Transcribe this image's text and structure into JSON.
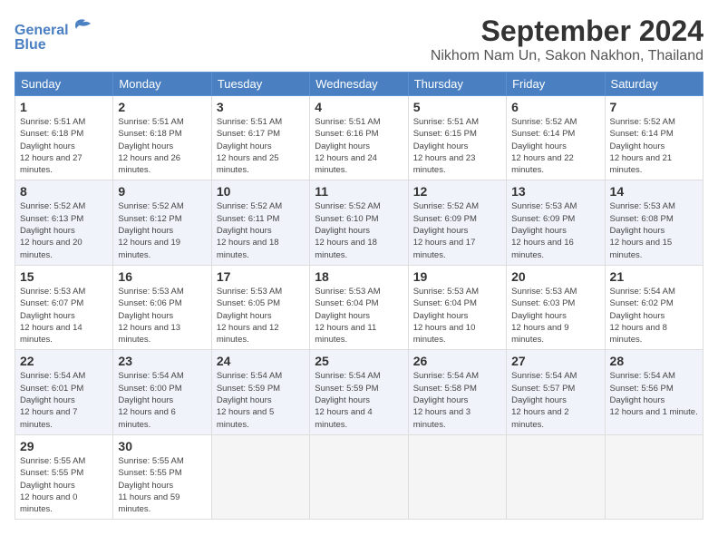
{
  "header": {
    "logo_general": "General",
    "logo_blue": "Blue",
    "month_title": "September 2024",
    "subtitle": "Nikhom Nam Un, Sakon Nakhon, Thailand"
  },
  "weekdays": [
    "Sunday",
    "Monday",
    "Tuesday",
    "Wednesday",
    "Thursday",
    "Friday",
    "Saturday"
  ],
  "weeks": [
    [
      {
        "day": 1,
        "sunrise": "5:51 AM",
        "sunset": "6:18 PM",
        "daylight": "12 hours and 27 minutes."
      },
      {
        "day": 2,
        "sunrise": "5:51 AM",
        "sunset": "6:18 PM",
        "daylight": "12 hours and 26 minutes."
      },
      {
        "day": 3,
        "sunrise": "5:51 AM",
        "sunset": "6:17 PM",
        "daylight": "12 hours and 25 minutes."
      },
      {
        "day": 4,
        "sunrise": "5:51 AM",
        "sunset": "6:16 PM",
        "daylight": "12 hours and 24 minutes."
      },
      {
        "day": 5,
        "sunrise": "5:51 AM",
        "sunset": "6:15 PM",
        "daylight": "12 hours and 23 minutes."
      },
      {
        "day": 6,
        "sunrise": "5:52 AM",
        "sunset": "6:14 PM",
        "daylight": "12 hours and 22 minutes."
      },
      {
        "day": 7,
        "sunrise": "5:52 AM",
        "sunset": "6:14 PM",
        "daylight": "12 hours and 21 minutes."
      }
    ],
    [
      {
        "day": 8,
        "sunrise": "5:52 AM",
        "sunset": "6:13 PM",
        "daylight": "12 hours and 20 minutes."
      },
      {
        "day": 9,
        "sunrise": "5:52 AM",
        "sunset": "6:12 PM",
        "daylight": "12 hours and 19 minutes."
      },
      {
        "day": 10,
        "sunrise": "5:52 AM",
        "sunset": "6:11 PM",
        "daylight": "12 hours and 18 minutes."
      },
      {
        "day": 11,
        "sunrise": "5:52 AM",
        "sunset": "6:10 PM",
        "daylight": "12 hours and 18 minutes."
      },
      {
        "day": 12,
        "sunrise": "5:52 AM",
        "sunset": "6:09 PM",
        "daylight": "12 hours and 17 minutes."
      },
      {
        "day": 13,
        "sunrise": "5:53 AM",
        "sunset": "6:09 PM",
        "daylight": "12 hours and 16 minutes."
      },
      {
        "day": 14,
        "sunrise": "5:53 AM",
        "sunset": "6:08 PM",
        "daylight": "12 hours and 15 minutes."
      }
    ],
    [
      {
        "day": 15,
        "sunrise": "5:53 AM",
        "sunset": "6:07 PM",
        "daylight": "12 hours and 14 minutes."
      },
      {
        "day": 16,
        "sunrise": "5:53 AM",
        "sunset": "6:06 PM",
        "daylight": "12 hours and 13 minutes."
      },
      {
        "day": 17,
        "sunrise": "5:53 AM",
        "sunset": "6:05 PM",
        "daylight": "12 hours and 12 minutes."
      },
      {
        "day": 18,
        "sunrise": "5:53 AM",
        "sunset": "6:04 PM",
        "daylight": "12 hours and 11 minutes."
      },
      {
        "day": 19,
        "sunrise": "5:53 AM",
        "sunset": "6:04 PM",
        "daylight": "12 hours and 10 minutes."
      },
      {
        "day": 20,
        "sunrise": "5:53 AM",
        "sunset": "6:03 PM",
        "daylight": "12 hours and 9 minutes."
      },
      {
        "day": 21,
        "sunrise": "5:54 AM",
        "sunset": "6:02 PM",
        "daylight": "12 hours and 8 minutes."
      }
    ],
    [
      {
        "day": 22,
        "sunrise": "5:54 AM",
        "sunset": "6:01 PM",
        "daylight": "12 hours and 7 minutes."
      },
      {
        "day": 23,
        "sunrise": "5:54 AM",
        "sunset": "6:00 PM",
        "daylight": "12 hours and 6 minutes."
      },
      {
        "day": 24,
        "sunrise": "5:54 AM",
        "sunset": "5:59 PM",
        "daylight": "12 hours and 5 minutes."
      },
      {
        "day": 25,
        "sunrise": "5:54 AM",
        "sunset": "5:59 PM",
        "daylight": "12 hours and 4 minutes."
      },
      {
        "day": 26,
        "sunrise": "5:54 AM",
        "sunset": "5:58 PM",
        "daylight": "12 hours and 3 minutes."
      },
      {
        "day": 27,
        "sunrise": "5:54 AM",
        "sunset": "5:57 PM",
        "daylight": "12 hours and 2 minutes."
      },
      {
        "day": 28,
        "sunrise": "5:54 AM",
        "sunset": "5:56 PM",
        "daylight": "12 hours and 1 minute."
      }
    ],
    [
      {
        "day": 29,
        "sunrise": "5:55 AM",
        "sunset": "5:55 PM",
        "daylight": "12 hours and 0 minutes."
      },
      {
        "day": 30,
        "sunrise": "5:55 AM",
        "sunset": "5:55 PM",
        "daylight": "11 hours and 59 minutes."
      },
      null,
      null,
      null,
      null,
      null
    ]
  ]
}
